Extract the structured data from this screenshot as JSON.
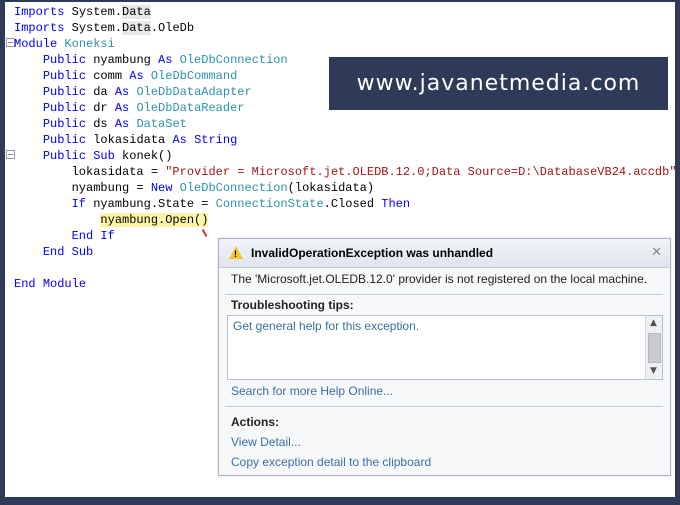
{
  "code": {
    "lines": [
      "Imports System.Data",
      "Imports System.Data.OleDb",
      "Module Koneksi",
      "    Public nyambung As OleDbConnection",
      "    Public comm As OleDbCommand",
      "    Public da As OleDbDataAdapter",
      "    Public dr As OleDbDataReader",
      "    Public ds As DataSet",
      "    Public lokasidata As String",
      "    Public Sub konek()",
      "        lokasidata = \"Provider = Microsoft.jet.OLEDB.12.0;Data Source=D:\\DatabaseVB24.accdb\"",
      "        nyambung = New OleDbConnection(lokasidata)",
      "        If nyambung.State = ConnectionState.Closed Then",
      "            nyambung.Open()",
      "        End If",
      "    End Sub",
      "",
      "End Module"
    ]
  },
  "watermark": "www.javanetmedia.com",
  "exception": {
    "title": "InvalidOperationException was unhandled",
    "message": "The 'Microsoft.jet.OLEDB.12.0' provider is not registered on the local machine.",
    "tips_heading": "Troubleshooting tips:",
    "tip_link": "Get general help for this exception.",
    "search_link": "Search for more Help Online...",
    "actions_heading": "Actions:",
    "view_detail": "View Detail...",
    "copy_detail": "Copy exception detail to the clipboard",
    "close_icon": "close-icon",
    "warning_icon": "warning-icon"
  }
}
